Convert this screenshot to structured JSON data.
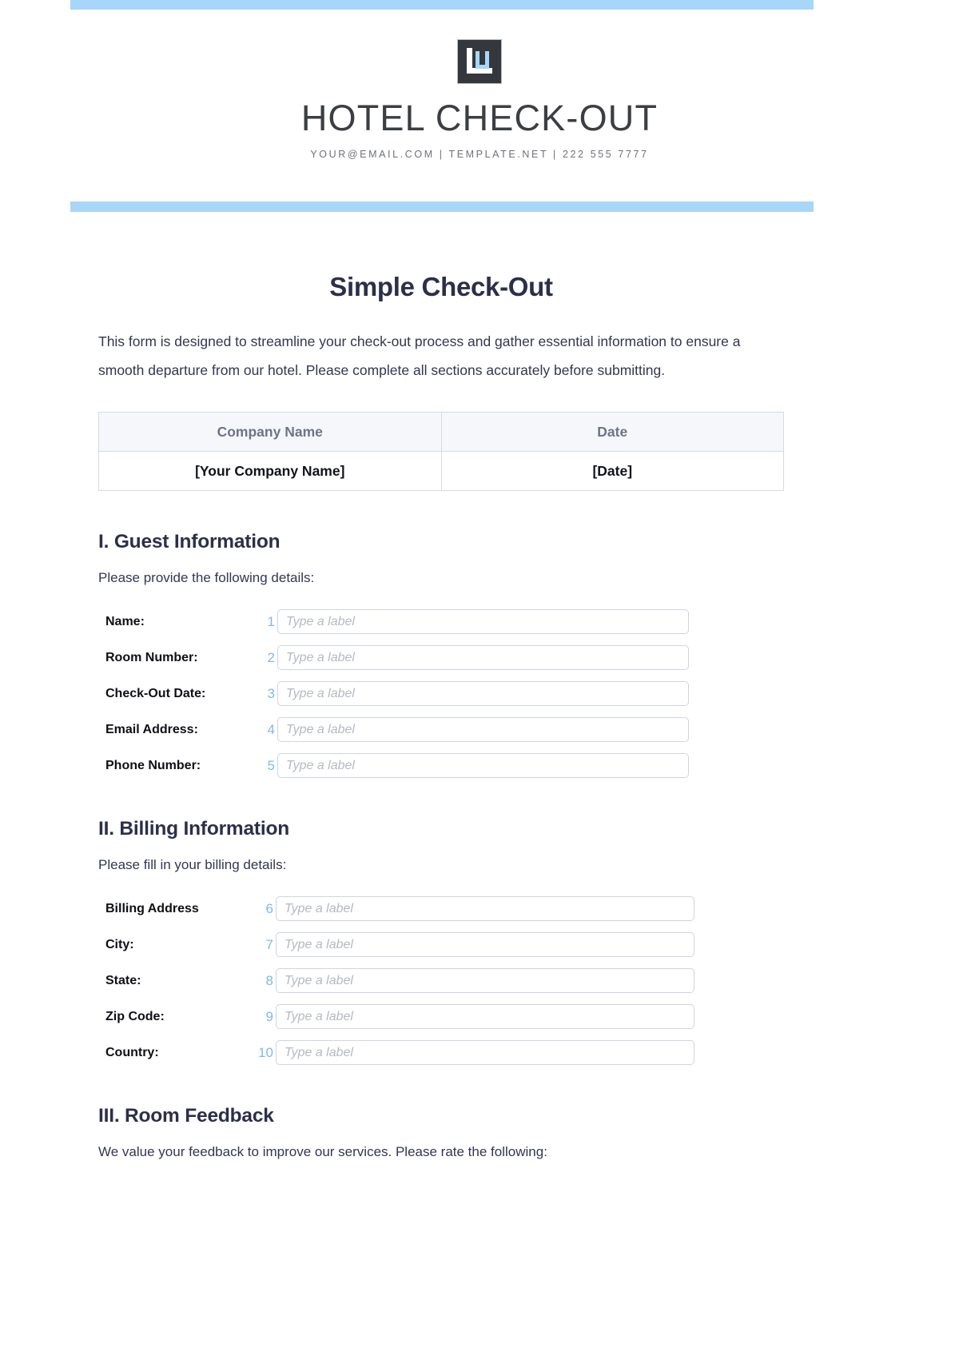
{
  "theme": {
    "accent_blue": "#a8d6f8",
    "number_blue": "#7db9ef",
    "heading_navy": "#2c2f4a",
    "logo_dark": "#34373b"
  },
  "letterhead": {
    "logo_icon": "bracket-logo-icon",
    "brand_title": "HOTEL CHECK-OUT",
    "contact_line": "YOUR@EMAIL.COM | TEMPLATE.NET | 222 555 7777"
  },
  "document": {
    "title": "Simple Check-Out",
    "intro": "This form is designed to streamline your check-out process and gather essential information to ensure a smooth departure from our hotel. Please complete all sections accurately before submitting."
  },
  "info_table": {
    "headers": [
      "Company Name",
      "Date"
    ],
    "rows": [
      [
        "[Your Company Name]",
        "[Date]"
      ]
    ]
  },
  "sections": [
    {
      "heading": "I. Guest Information",
      "subtitle": "Please provide the following details:",
      "fields": [
        {
          "num": "1",
          "label": "Name:",
          "placeholder": "Type a label",
          "value": ""
        },
        {
          "num": "2",
          "label": "Room Number:",
          "placeholder": "Type a label",
          "value": ""
        },
        {
          "num": "3",
          "label": "Check-Out Date:",
          "placeholder": "Type a label",
          "value": ""
        },
        {
          "num": "4",
          "label": "Email Address:",
          "placeholder": "Type a label",
          "value": ""
        },
        {
          "num": "5",
          "label": "Phone Number:",
          "placeholder": "Type a label",
          "value": ""
        }
      ]
    },
    {
      "heading": "II. Billing Information",
      "subtitle": "Please fill in your billing details:",
      "fields": [
        {
          "num": "6",
          "label": "Billing Address",
          "placeholder": "Type a label",
          "value": ""
        },
        {
          "num": "7",
          "label": "City:",
          "placeholder": "Type a label",
          "value": ""
        },
        {
          "num": "8",
          "label": "State:",
          "placeholder": "Type a label",
          "value": ""
        },
        {
          "num": "9",
          "label": "Zip Code:",
          "placeholder": "Type a label",
          "value": ""
        },
        {
          "num": "10",
          "label": "Country:",
          "placeholder": "Type a label",
          "value": ""
        }
      ]
    },
    {
      "heading": "III. Room Feedback",
      "subtitle": "We value your feedback to improve our services. Please rate the following:",
      "fields": []
    }
  ]
}
